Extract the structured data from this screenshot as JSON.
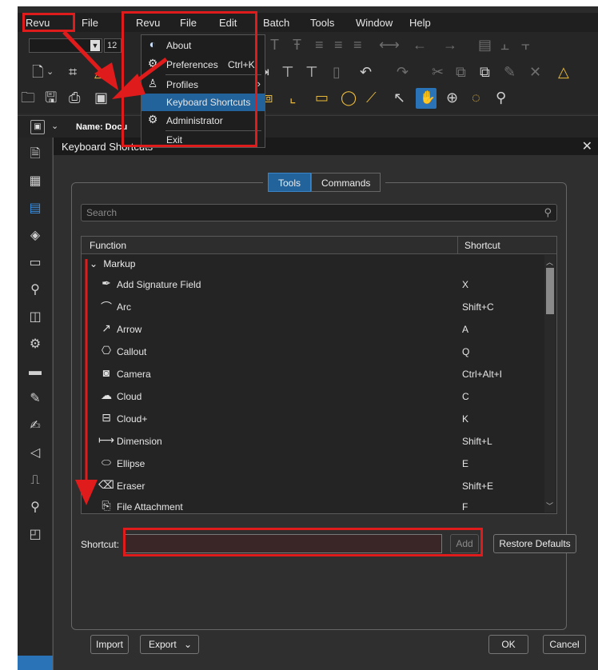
{
  "menubar": {
    "items": [
      "Revu",
      "File",
      "Revu",
      "File",
      "Edit",
      "Batch",
      "Tools",
      "Window",
      "Help"
    ]
  },
  "zoom_value": "12",
  "name_bar": {
    "label": "Name: Docu"
  },
  "revu_menu": {
    "items": [
      {
        "label": "About",
        "shortcut": "",
        "icon": "bluebeam-logo-icon"
      },
      {
        "label": "Preferences",
        "shortcut": "Ctrl+K",
        "icon": "gear-icon"
      },
      {
        "label": "Profiles",
        "shortcut": "",
        "icon": "user-icon",
        "submenu": true
      },
      {
        "label": "Keyboard Shortcuts",
        "shortcut": "",
        "icon": "",
        "highlighted": true
      },
      {
        "label": "Administrator",
        "shortcut": "",
        "icon": "admin-icon"
      },
      {
        "label": "Exit",
        "shortcut": "",
        "icon": ""
      }
    ]
  },
  "dialog": {
    "title": "Keyboard Shortcuts",
    "tabs": [
      "Tools",
      "Commands"
    ],
    "search_placeholder": "Search",
    "columns": [
      "Function",
      "Shortcut"
    ],
    "group": "Markup",
    "rows": [
      {
        "function": "Add Signature Field",
        "shortcut": "X",
        "icon": "signature-icon"
      },
      {
        "function": "Arc",
        "shortcut": "Shift+C",
        "icon": "arc-icon"
      },
      {
        "function": "Arrow",
        "shortcut": "A",
        "icon": "arrow-icon"
      },
      {
        "function": "Callout",
        "shortcut": "Q",
        "icon": "callout-icon"
      },
      {
        "function": "Camera",
        "shortcut": "Ctrl+Alt+I",
        "icon": "camera-icon"
      },
      {
        "function": "Cloud",
        "shortcut": "C",
        "icon": "cloud-icon"
      },
      {
        "function": "Cloud+",
        "shortcut": "K",
        "icon": "cloud-plus-icon"
      },
      {
        "function": "Dimension",
        "shortcut": "Shift+L",
        "icon": "dimension-icon"
      },
      {
        "function": "Ellipse",
        "shortcut": "E",
        "icon": "ellipse-icon"
      },
      {
        "function": "Eraser",
        "shortcut": "Shift+E",
        "icon": "eraser-icon"
      },
      {
        "function": "File Attachment",
        "shortcut": "F",
        "icon": "attachment-icon"
      }
    ],
    "shortcut_label": "Shortcut:",
    "shortcut_value": "",
    "add_label": "Add",
    "restore_label": "Restore Defaults",
    "import_label": "Import",
    "export_label": "Export",
    "ok_label": "OK",
    "cancel_label": "Cancel"
  },
  "colors": {
    "accent": "#22639c",
    "annotation": "#e01b1b",
    "background": "#2b2b2b"
  }
}
